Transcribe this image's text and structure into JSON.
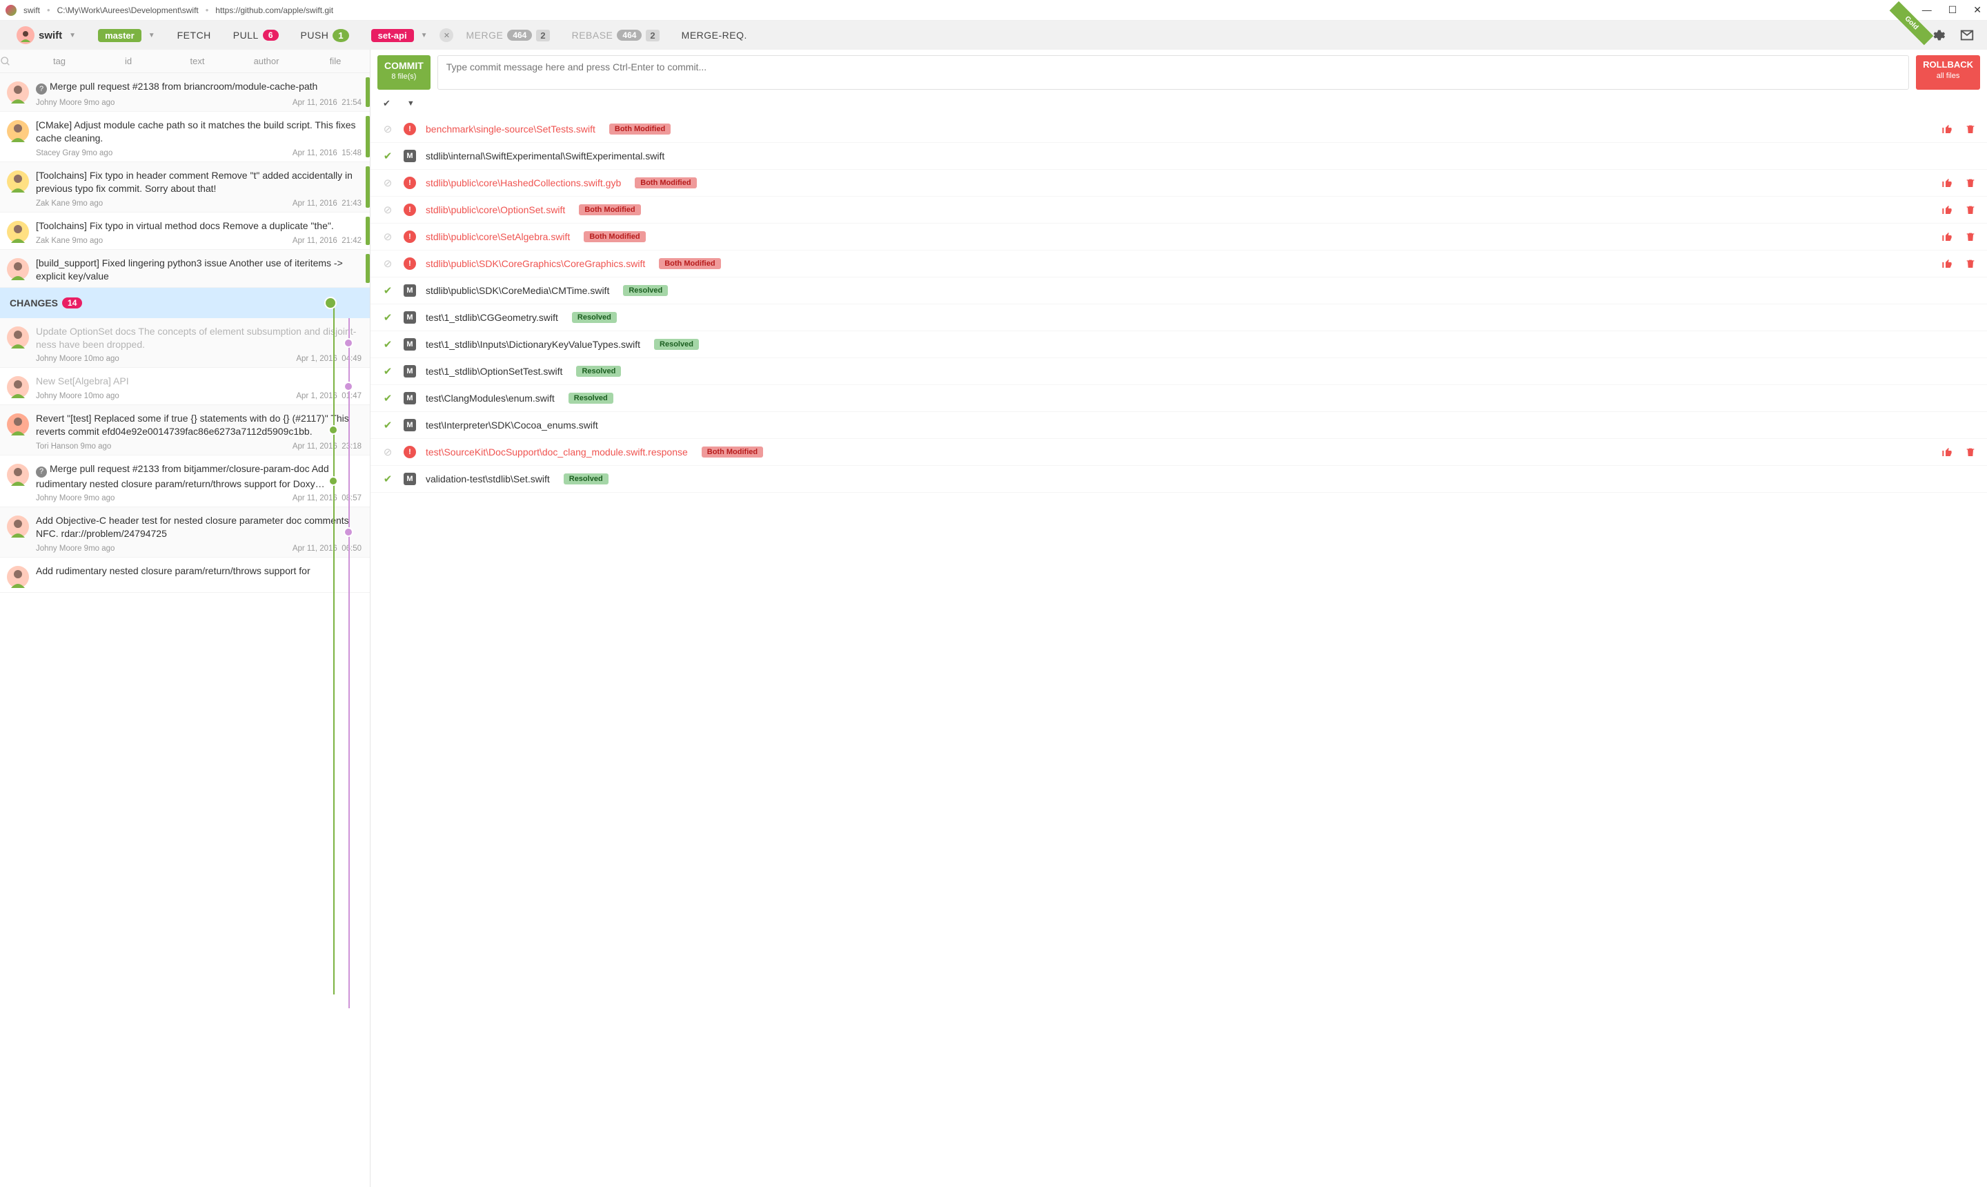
{
  "titlebar": {
    "project": "swift",
    "path": "C:\\My\\Work\\Aurees\\Development\\swift",
    "url": "https://github.com/apple/swift.git"
  },
  "toolbar": {
    "project": "swift",
    "branch": "master",
    "fetch": "FETCH",
    "pull": "PULL",
    "pull_count": "6",
    "push": "PUSH",
    "push_count": "1",
    "feature": "set-api",
    "merge": "MERGE",
    "merge_count": "464",
    "merge_sub": "2",
    "rebase": "REBASE",
    "rebase_count": "464",
    "rebase_sub": "2",
    "mr": "MERGE-REQ.",
    "gold": "Gold"
  },
  "filters": {
    "tag": "tag",
    "id": "id",
    "text": "text",
    "author": "author",
    "file": "file"
  },
  "changes": {
    "label": "CHANGES",
    "count": "14"
  },
  "commits": [
    {
      "msg": "Merge pull request #2138 from briancroom/module-cache-path",
      "author": "Johny Moore 9mo ago",
      "date": "Apr 11, 2016",
      "time": "21:54",
      "merge": true,
      "av": "pink"
    },
    {
      "msg": "[CMake] Adjust module cache path so it matches the build script. This fixes cache cleaning.",
      "author": "Stacey Gray 9mo ago",
      "date": "Apr 11, 2016",
      "time": "15:48",
      "av": "orange"
    },
    {
      "msg": "[Toolchains] Fix typo in header comment Remove \"t\" added accidentally in previous typo fix commit. Sorry about that!",
      "author": "Zak Kane 9mo ago",
      "date": "Apr 11, 2016",
      "time": "21:43",
      "av": "blond"
    },
    {
      "msg": "[Toolchains] Fix typo in virtual method docs Remove a duplicate \"the\".",
      "author": "Zak Kane 9mo ago",
      "date": "Apr 11, 2016",
      "time": "21:42",
      "av": "blond"
    },
    {
      "msg": "[build_support] Fixed lingering python3 issue Another use of iteritems -> explicit key/value",
      "author": "",
      "date": "",
      "time": "",
      "av": "pink",
      "cut": true
    }
  ],
  "commits2": [
    {
      "msg": "Update OptionSet docs The concepts of element subsumption and disjoint-ness have been dropped.",
      "author": "Johny Moore 10mo ago",
      "date": "Apr 1, 2016",
      "time": "04:49",
      "dim": true,
      "av": "pink",
      "dot": "p"
    },
    {
      "msg": "New Set[Algebra] API",
      "author": "Johny Moore 10mo ago",
      "date": "Apr 1, 2016",
      "time": "01:47",
      "dim": true,
      "av": "pink",
      "dot": "p"
    },
    {
      "msg": "Revert \"[test] Replaced some if true {} statements with do {} (#2117)\" This reverts commit efd04e92e0014739fac86e6273a7112d5909c1bb.",
      "author": "Tori Hanson 9mo ago",
      "date": "Apr 11, 2016",
      "time": "23:18",
      "av": "red",
      "dot": "g"
    },
    {
      "msg": "Merge pull request #2133 from bitjammer/closure-param-doc Add rudimentary nested closure param/return/throws support for Doxy…",
      "author": "Johny Moore 9mo ago",
      "date": "Apr 11, 2016",
      "time": "08:57",
      "merge": true,
      "av": "pink",
      "dot": "g"
    },
    {
      "msg": "Add Objective-C header test for nested closure parameter doc comments NFC. rdar://problem/24794725",
      "author": "Johny Moore 9mo ago",
      "date": "Apr 11, 2016",
      "time": "06:50",
      "av": "pink",
      "dot": "p"
    },
    {
      "msg": "Add rudimentary nested closure param/return/throws support for",
      "author": "",
      "date": "",
      "time": "",
      "av": "pink",
      "cut": true
    }
  ],
  "commitbox": {
    "commit_label": "COMMIT",
    "commit_sub": "8 file(s)",
    "placeholder": "Type commit message here and press Ctrl-Enter to commit...",
    "rollback_label": "ROLLBACK",
    "rollback_sub": "all files"
  },
  "files": [
    {
      "staged": "skip",
      "icon": "alert",
      "path": "benchmark\\single-source\\SetTests.swift",
      "badge": "Both Modified",
      "conflict": true,
      "actions": true
    },
    {
      "staged": "ok",
      "icon": "mod",
      "path": "stdlib\\internal\\SwiftExperimental\\SwiftExperimental.swift"
    },
    {
      "staged": "skip",
      "icon": "alert",
      "path": "stdlib\\public\\core\\HashedCollections.swift.gyb",
      "badge": "Both Modified",
      "conflict": true,
      "actions": true
    },
    {
      "staged": "skip",
      "icon": "alert",
      "path": "stdlib\\public\\core\\OptionSet.swift",
      "badge": "Both Modified",
      "conflict": true,
      "actions": true
    },
    {
      "staged": "skip",
      "icon": "alert",
      "path": "stdlib\\public\\core\\SetAlgebra.swift",
      "badge": "Both Modified",
      "conflict": true,
      "actions": true
    },
    {
      "staged": "skip",
      "icon": "alert",
      "path": "stdlib\\public\\SDK\\CoreGraphics\\CoreGraphics.swift",
      "badge": "Both Modified",
      "conflict": true,
      "actions": true
    },
    {
      "staged": "ok",
      "icon": "mod",
      "path": "stdlib\\public\\SDK\\CoreMedia\\CMTime.swift",
      "badge": "Resolved",
      "resolved": true
    },
    {
      "staged": "ok",
      "icon": "mod",
      "path": "test\\1_stdlib\\CGGeometry.swift",
      "badge": "Resolved",
      "resolved": true
    },
    {
      "staged": "ok",
      "icon": "mod",
      "path": "test\\1_stdlib\\Inputs\\DictionaryKeyValueTypes.swift",
      "badge": "Resolved",
      "resolved": true
    },
    {
      "staged": "ok",
      "icon": "mod",
      "path": "test\\1_stdlib\\OptionSetTest.swift",
      "badge": "Resolved",
      "resolved": true
    },
    {
      "staged": "ok",
      "icon": "mod",
      "path": "test\\ClangModules\\enum.swift",
      "badge": "Resolved",
      "resolved": true
    },
    {
      "staged": "ok",
      "icon": "mod",
      "path": "test\\Interpreter\\SDK\\Cocoa_enums.swift"
    },
    {
      "staged": "skip",
      "icon": "alert",
      "path": "test\\SourceKit\\DocSupport\\doc_clang_module.swift.response",
      "badge": "Both Modified",
      "conflict": true,
      "actions": true
    },
    {
      "staged": "ok",
      "icon": "mod",
      "path": "validation-test\\stdlib\\Set.swift",
      "badge": "Resolved",
      "resolved": true
    }
  ]
}
